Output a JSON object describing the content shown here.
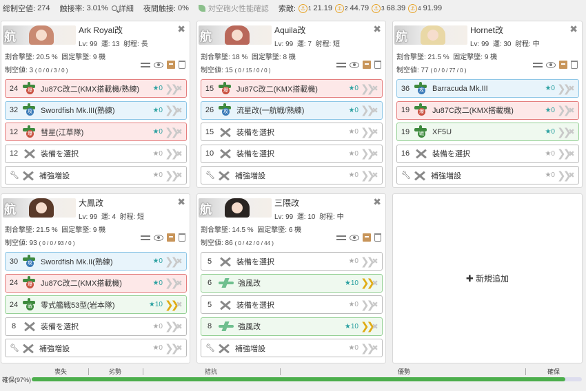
{
  "topbar": {
    "air_power_label": "総制空値:",
    "air_power": "274",
    "contact_label": "触接率:",
    "contact": "3.01%",
    "detail_label": "詳細",
    "night_label": "夜間触接:",
    "night": "0%",
    "aa_label": "対空砲火性能確認",
    "los_label": "索敵:",
    "los": [
      {
        "lv": "1",
        "value": "21.19"
      },
      {
        "lv": "2",
        "value": "44.79"
      },
      {
        "lv": "3",
        "value": "68.39"
      },
      {
        "lv": "4",
        "value": "91.99"
      }
    ]
  },
  "ships": [
    {
      "name": "Ark Royal改",
      "lv": "Lv: 99",
      "luck": "運: 13",
      "range": "射程: 長",
      "shotdown_rate": "割合撃墜: 20.5 %",
      "shotdown_fixed": "固定撃墜: 9 機",
      "air_label": "制空値: 3",
      "air_detail": "( 0 / 0 / 3 / 0 )",
      "slots": [
        {
          "count": "24",
          "name": "Ju87C改二(KMX搭載機/熟練)",
          "star": "★0"
        },
        {
          "count": "32",
          "name": "Swordfish Mk.III(熟練)",
          "star": "★0"
        },
        {
          "count": "12",
          "name": "彗星(江草隊)",
          "star": "★0"
        },
        {
          "count": "12",
          "name": "装備を選択",
          "star": "★0"
        },
        {
          "count": "",
          "name": "補強増設",
          "star": "★0"
        }
      ]
    },
    {
      "name": "Aquila改",
      "lv": "Lv: 99",
      "luck": "運: 7",
      "range": "射程: 短",
      "shotdown_rate": "割合撃墜: 18 %",
      "shotdown_fixed": "固定撃墜: 8 機",
      "air_label": "制空値: 15",
      "air_detail": "( 0 / 15 / 0 / 0 )",
      "slots": [
        {
          "count": "15",
          "name": "Ju87C改二(KMX搭載機)",
          "star": "★0"
        },
        {
          "count": "26",
          "name": "流星改(一航戦/熟練)",
          "star": "★0"
        },
        {
          "count": "15",
          "name": "装備を選択",
          "star": "★0"
        },
        {
          "count": "10",
          "name": "装備を選択",
          "star": "★0"
        },
        {
          "count": "",
          "name": "補強増設",
          "star": "★0"
        }
      ]
    },
    {
      "name": "Hornet改",
      "lv": "Lv: 99",
      "luck": "運: 30",
      "range": "射程: 中",
      "shotdown_rate": "割合撃墜: 21.5 %",
      "shotdown_fixed": "固定撃墜: 9 機",
      "air_label": "制空値: 77",
      "air_detail": "( 0 / 0 / 77 / 0 )",
      "slots": [
        {
          "count": "36",
          "name": "Barracuda Mk.III",
          "star": "★0"
        },
        {
          "count": "19",
          "name": "Ju87C改二(KMX搭載機)",
          "star": "★0"
        },
        {
          "count": "19",
          "name": "XF5U",
          "star": "★0"
        },
        {
          "count": "16",
          "name": "装備を選択",
          "star": "★0"
        },
        {
          "count": "",
          "name": "補強増設",
          "star": "★0"
        }
      ]
    },
    {
      "name": "大鳳改",
      "lv": "Lv: 99",
      "luck": "運: 4",
      "range": "射程: 短",
      "shotdown_rate": "割合撃墜: 21.5 %",
      "shotdown_fixed": "固定撃墜: 9 機",
      "air_label": "制空値: 93",
      "air_detail": "( 0 / 0 / 93 / 0 )",
      "slots": [
        {
          "count": "30",
          "name": "Swordfish Mk.II(熟練)",
          "star": "★0"
        },
        {
          "count": "24",
          "name": "Ju87C改二(KMX搭載機)",
          "star": "★0"
        },
        {
          "count": "24",
          "name": "零式艦戦53型(岩本隊)",
          "star": "★10"
        },
        {
          "count": "8",
          "name": "装備を選択",
          "star": "★0"
        },
        {
          "count": "",
          "name": "補強増設",
          "star": "★0"
        }
      ]
    },
    {
      "name": "三隈改",
      "lv": "Lv: 99",
      "luck": "運: 10",
      "range": "射程: 中",
      "shotdown_rate": "割合撃墜: 14.5 %",
      "shotdown_fixed": "固定撃墜: 6 機",
      "air_label": "制空値: 86",
      "air_detail": "( 0 / 42 / 0 / 44 )",
      "slots": [
        {
          "count": "5",
          "name": "装備を選択",
          "star": "★0"
        },
        {
          "count": "6",
          "name": "強風改",
          "star": "★10"
        },
        {
          "count": "5",
          "name": "装備を選択",
          "star": "★0"
        },
        {
          "count": "8",
          "name": "強風改",
          "star": "★10"
        },
        {
          "count": "",
          "name": "補強増設",
          "star": "★0"
        }
      ]
    }
  ],
  "add_label": "新規追加",
  "scale": [
    "喪失",
    "劣勢",
    "拮抗",
    "優勢",
    "確保"
  ],
  "airstate": {
    "label": "確保(97%)",
    "percent": 97
  },
  "colors": {
    "bar": "#4cae4c",
    "red_slot": "#e47e7e",
    "blue_slot": "#8ec6e6",
    "green_slot": "#95d095"
  }
}
